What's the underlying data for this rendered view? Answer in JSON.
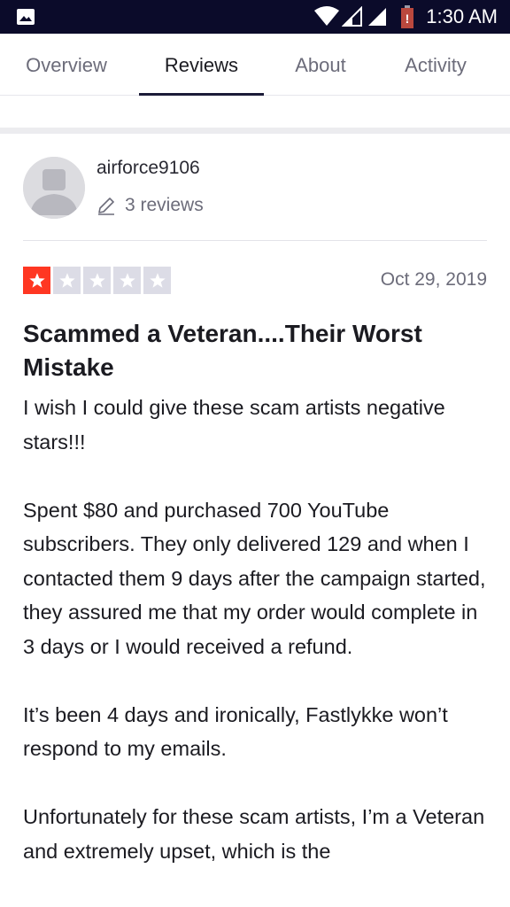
{
  "status_bar": {
    "time": "1:30 AM",
    "icons": [
      "gallery-icon",
      "wifi-icon",
      "signal-icon",
      "signal-icon",
      "battery-alert-icon"
    ],
    "battery_alert": "!",
    "background_color": "#0b0b2a",
    "battery_color": "#e53935"
  },
  "tabs": [
    {
      "label": "Overview",
      "active": false
    },
    {
      "label": "Reviews",
      "active": true
    },
    {
      "label": "About",
      "active": false
    },
    {
      "label": "Activity",
      "active": false
    }
  ],
  "review": {
    "author": "airforce9106",
    "review_count": "3 reviews",
    "rating": 1,
    "max_rating": 5,
    "date": "Oct 29, 2019",
    "title": "Scammed a Veteran....Their Worst Mistake",
    "paragraphs": [
      "I wish I could give these scam artists negative stars!!!",
      "Spent $80 and purchased 700 YouTube subscribers. They only delivered 129 and when I contacted them 9 days after the campaign started, they assured me that my order would complete in 3 days or I would received a refund.",
      "It’s been 4 days and ironically, Fastlykke won’t respond to my emails.",
      "Unfortunately for these scam artists, I’m a Veteran and extremely upset, which is the"
    ]
  },
  "colors": {
    "star_filled": "#ff3722",
    "star_empty": "#dcdce6",
    "tab_indicator": "#1b1b38"
  }
}
